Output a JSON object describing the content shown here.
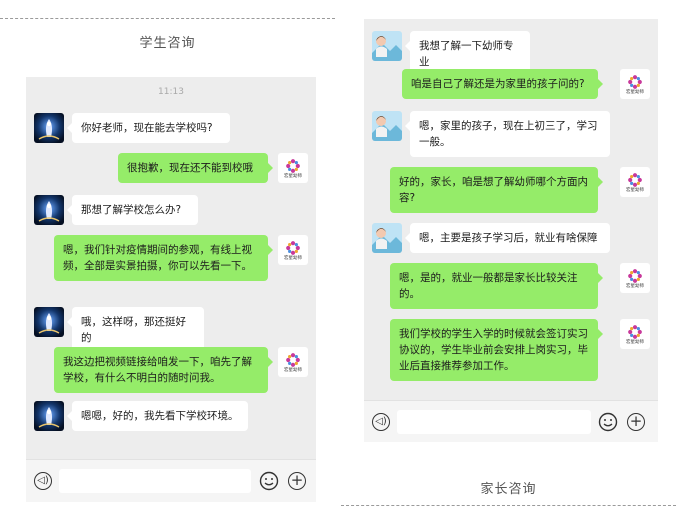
{
  "left_caption": "学生咨询",
  "right_caption": "家长咨询",
  "left_chat": {
    "time": "11:13",
    "messages": [
      {
        "side": "left",
        "text": "你好老师，现在能去学校吗?"
      },
      {
        "side": "right",
        "text": "很抱歉，现在还不能到校哦"
      },
      {
        "side": "left",
        "text": "那想了解学校怎么办?"
      },
      {
        "side": "right",
        "text": "嗯，我们针对疫情期间的参观，有线上视频，全部是实景拍摄，你可以先看一下。"
      },
      {
        "side": "left",
        "text": "哦，这样呀，那还挺好的"
      },
      {
        "side": "right",
        "text": "我这边把视频链接给咱发一下，咱先了解学校，有什么不明白的随时问我。"
      },
      {
        "side": "left",
        "text": "嗯嗯，好的，我先看下学校环境。"
      }
    ]
  },
  "right_chat": {
    "messages": [
      {
        "side": "left",
        "text": "我想了解一下幼师专业"
      },
      {
        "side": "right",
        "text": "咱是自己了解还是为家里的孩子问的?"
      },
      {
        "side": "left",
        "text": "嗯，家里的孩子，现在上初三了，学习一般。"
      },
      {
        "side": "right",
        "text": "好的，家长，咱是想了解幼师哪个方面内容?"
      },
      {
        "side": "left",
        "text": "嗯，主要是孩子学习后，就业有啥保障"
      },
      {
        "side": "right",
        "text": "嗯，是的，就业一般都是家长比较关注的。"
      },
      {
        "side": "right",
        "text": "我们学校的学生入学的时候就会签订实习协议的，学生毕业前会安排上岗实习，毕业后直接推荐参加工作。"
      }
    ]
  },
  "school_logo_text": "宏星幼师",
  "colors": {
    "panel_bg": "#ededed",
    "bubble_green": "#95ec69",
    "bubble_white": "#ffffff"
  },
  "icons": {
    "voice": "voice-icon",
    "emoji": "emoji-icon",
    "plus": "plus-icon"
  }
}
